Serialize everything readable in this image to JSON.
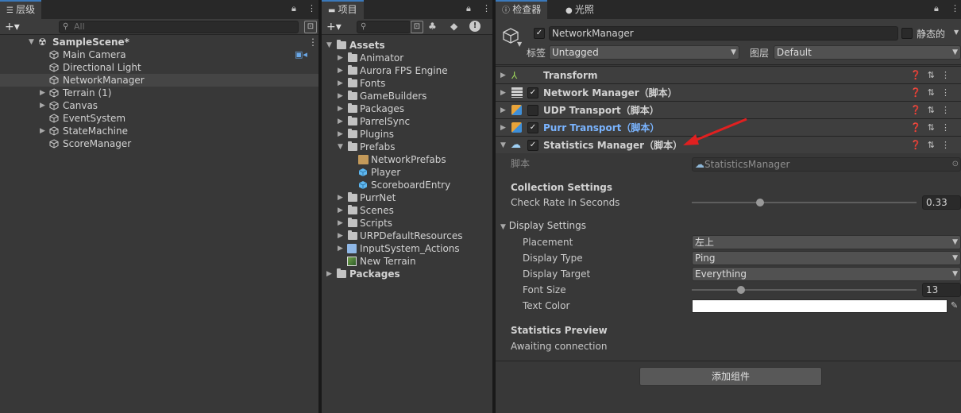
{
  "hierarchy": {
    "tab_label": "层级",
    "search_placeholder": "All",
    "scene_name": "SampleScene*",
    "items": [
      {
        "label": "Main Camera"
      },
      {
        "label": "Directional Light"
      },
      {
        "label": "NetworkManager"
      },
      {
        "label": "Terrain (1)"
      },
      {
        "label": "Canvas"
      },
      {
        "label": "EventSystem"
      },
      {
        "label": "StateMachine"
      },
      {
        "label": "ScoreManager"
      }
    ]
  },
  "project": {
    "tab_label": "项目",
    "items": [
      {
        "label": "Assets"
      },
      {
        "label": "Animator"
      },
      {
        "label": "Aurora FPS Engine"
      },
      {
        "label": "Fonts"
      },
      {
        "label": "GameBuilders"
      },
      {
        "label": "Packages"
      },
      {
        "label": "ParrelSync"
      },
      {
        "label": "Plugins"
      },
      {
        "label": "Prefabs"
      },
      {
        "label": "NetworkPrefabs"
      },
      {
        "label": "Player"
      },
      {
        "label": "ScoreboardEntry"
      },
      {
        "label": "PurrNet"
      },
      {
        "label": "Scenes"
      },
      {
        "label": "Scripts"
      },
      {
        "label": "URPDefaultResources"
      },
      {
        "label": "InputSystem_Actions"
      },
      {
        "label": "New Terrain"
      },
      {
        "label": "Packages"
      }
    ]
  },
  "inspector": {
    "tab_label": "检查器",
    "lighting_tab_label": "光照",
    "object_name": "NetworkManager",
    "static_label": "静态的",
    "tag_label": "标签",
    "tag_value": "Untagged",
    "layer_label": "图层",
    "layer_value": "Default",
    "components": [
      {
        "label": "Transform"
      },
      {
        "label": "Network Manager（脚本）"
      },
      {
        "label": "UDP Transport（脚本）"
      },
      {
        "label": "Purr Transport（脚本）"
      },
      {
        "label": "Statistics Manager（脚本）"
      }
    ],
    "script_label": "脚本",
    "script_value": "StatisticsManager",
    "collection_settings": "Collection Settings",
    "check_rate_label": "Check Rate In Seconds",
    "check_rate_value": "0.33",
    "check_rate_fraction": 0.33,
    "display_settings": "Display Settings",
    "placement_label": "Placement",
    "placement_value": "左上",
    "display_type_label": "Display Type",
    "display_type_value": "Ping",
    "display_target_label": "Display Target",
    "display_target_value": "Everything",
    "font_size_label": "Font Size",
    "font_size_value": "13",
    "text_color_label": "Text Color",
    "text_color": "#ffffff",
    "stats_preview": "Statistics Preview",
    "awaiting": "Awaiting connection",
    "add_component": "添加组件"
  },
  "colors": {
    "accent": "#3a79bb",
    "purr_transport_text": "#7ab4ff",
    "annotation_arrow": "#e02020"
  }
}
